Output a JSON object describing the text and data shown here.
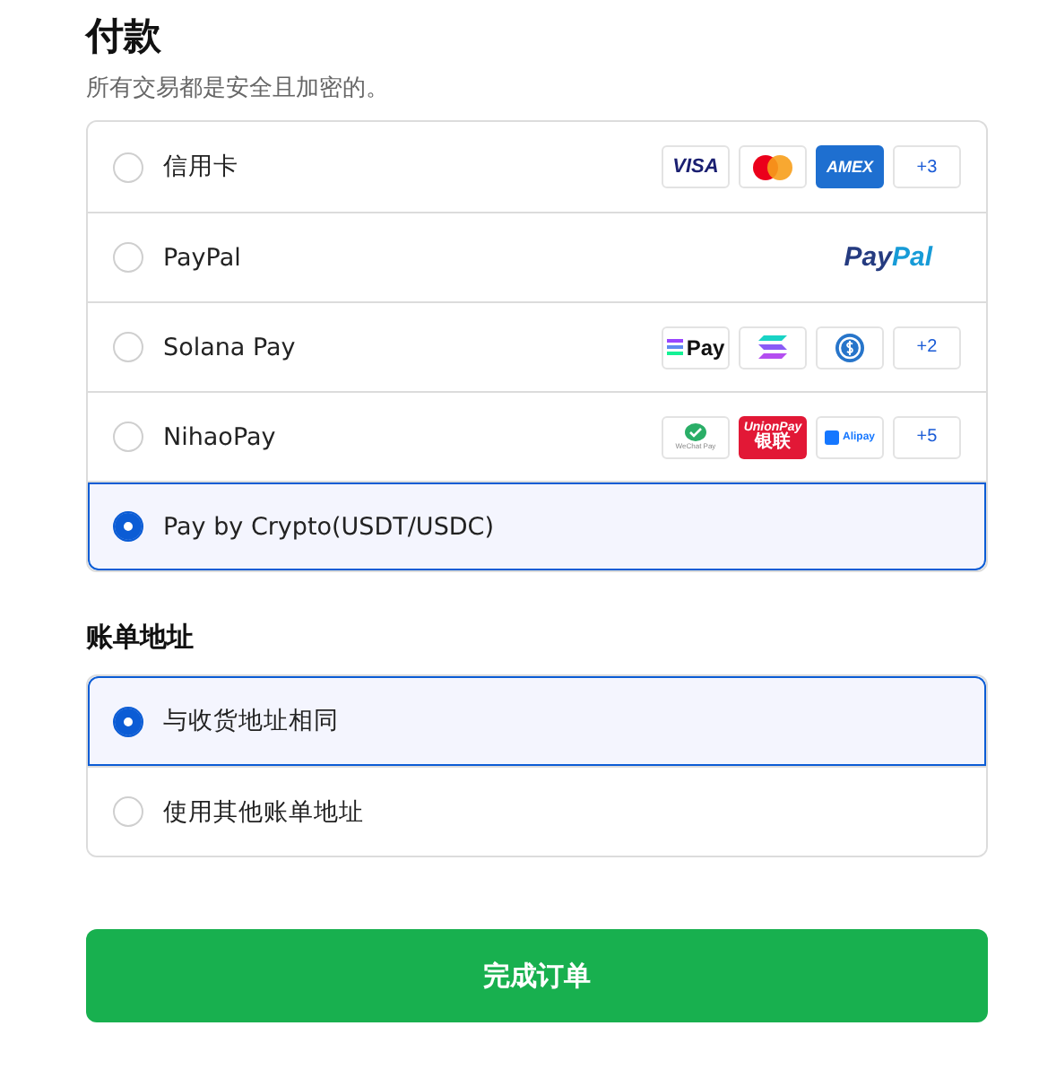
{
  "payment": {
    "title": "付款",
    "subtitle": "所有交易都是安全且加密的。",
    "methods": [
      {
        "label": "信用卡",
        "selected": false,
        "badges": [
          {
            "kind": "visa",
            "text": "VISA"
          },
          {
            "kind": "mastercard"
          },
          {
            "kind": "amex",
            "text": "AMEX"
          },
          {
            "kind": "more",
            "text": "+3"
          }
        ]
      },
      {
        "label": "PayPal",
        "selected": false,
        "badges": [
          {
            "kind": "paypal",
            "text": "PayPal"
          }
        ]
      },
      {
        "label": "Solana Pay",
        "selected": false,
        "badges": [
          {
            "kind": "solanapay",
            "text": "Pay"
          },
          {
            "kind": "solana"
          },
          {
            "kind": "usdc"
          },
          {
            "kind": "more",
            "text": "+2"
          }
        ]
      },
      {
        "label": "NihaoPay",
        "selected": false,
        "badges": [
          {
            "kind": "wechat",
            "text": "WeChat Pay"
          },
          {
            "kind": "unionpay",
            "text": "UnionPay",
            "subtext": "银联"
          },
          {
            "kind": "alipay",
            "text": "Alipay"
          },
          {
            "kind": "more",
            "text": "+5"
          }
        ]
      },
      {
        "label": "Pay by Crypto(USDT/USDC)",
        "selected": true
      }
    ]
  },
  "billing": {
    "title": "账单地址",
    "options": [
      {
        "label": "与收货地址相同",
        "selected": true
      },
      {
        "label": "使用其他账单地址",
        "selected": false
      }
    ]
  },
  "submit": "完成订单"
}
